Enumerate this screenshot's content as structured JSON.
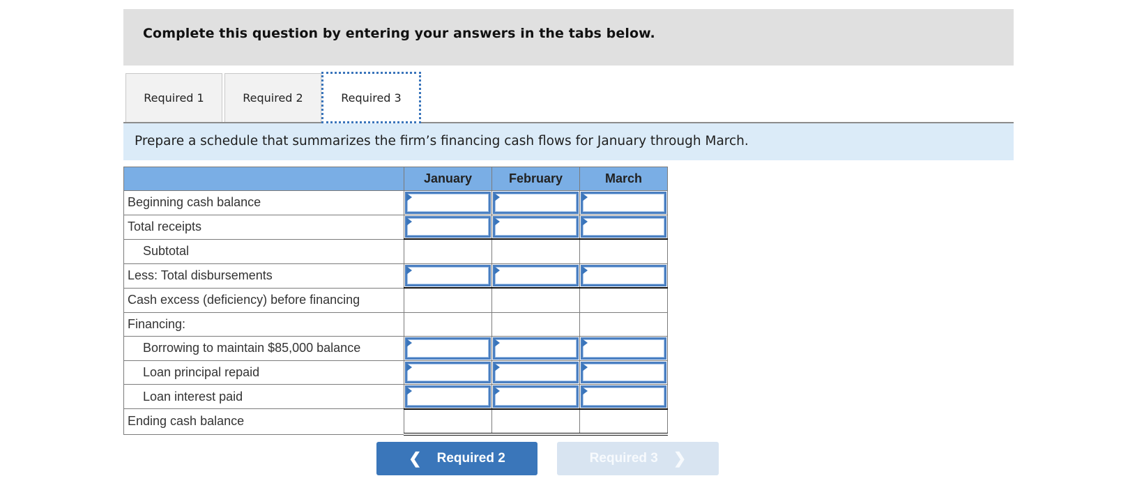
{
  "header": {
    "title": "Complete this question by entering your answers in the tabs below."
  },
  "tabs": [
    {
      "label": "Required 1",
      "active": false
    },
    {
      "label": "Required 2",
      "active": false
    },
    {
      "label": "Required 3",
      "active": true
    }
  ],
  "instruction": "Prepare a schedule that summarizes the firm’s financing cash flows for January through March.",
  "table": {
    "columns": [
      "",
      "January",
      "February",
      "March"
    ],
    "rows": [
      {
        "label": "Beginning cash balance",
        "indent": false,
        "editable": true,
        "values": [
          "",
          "",
          ""
        ]
      },
      {
        "label": "Total receipts",
        "indent": false,
        "editable": true,
        "values": [
          "",
          "",
          ""
        ]
      },
      {
        "label": "Subtotal",
        "indent": true,
        "editable": false,
        "values": [
          "",
          "",
          ""
        ]
      },
      {
        "label": "Less: Total disbursements",
        "indent": false,
        "editable": true,
        "values": [
          "",
          "",
          ""
        ]
      },
      {
        "label": "Cash excess (deficiency) before financing",
        "indent": false,
        "editable": false,
        "values": [
          "",
          "",
          ""
        ]
      },
      {
        "label": "Financing:",
        "indent": false,
        "editable": false,
        "values": [
          "",
          "",
          ""
        ]
      },
      {
        "label": "Borrowing to maintain $85,000 balance",
        "indent": true,
        "editable": true,
        "values": [
          "",
          "",
          ""
        ]
      },
      {
        "label": "Loan principal repaid",
        "indent": true,
        "editable": true,
        "values": [
          "",
          "",
          ""
        ]
      },
      {
        "label": "Loan interest paid",
        "indent": true,
        "editable": true,
        "values": [
          "",
          "",
          ""
        ]
      },
      {
        "label": "Ending cash balance",
        "indent": false,
        "editable": false,
        "values": [
          "",
          "",
          ""
        ]
      }
    ]
  },
  "nav": {
    "prev_label": "Required 2",
    "next_label": "Required 3",
    "prev_icon": "chevron-left-icon",
    "next_icon": "chevron-right-icon",
    "next_disabled": true
  },
  "colors": {
    "header_bg": "#e0e0e0",
    "instruction_bg": "#dbebf8",
    "table_header_bg": "#7aaee5",
    "input_border": "#4a7fc1",
    "prev_button_bg": "#3a76ba",
    "next_button_bg_disabled": "#d8e4f1"
  }
}
